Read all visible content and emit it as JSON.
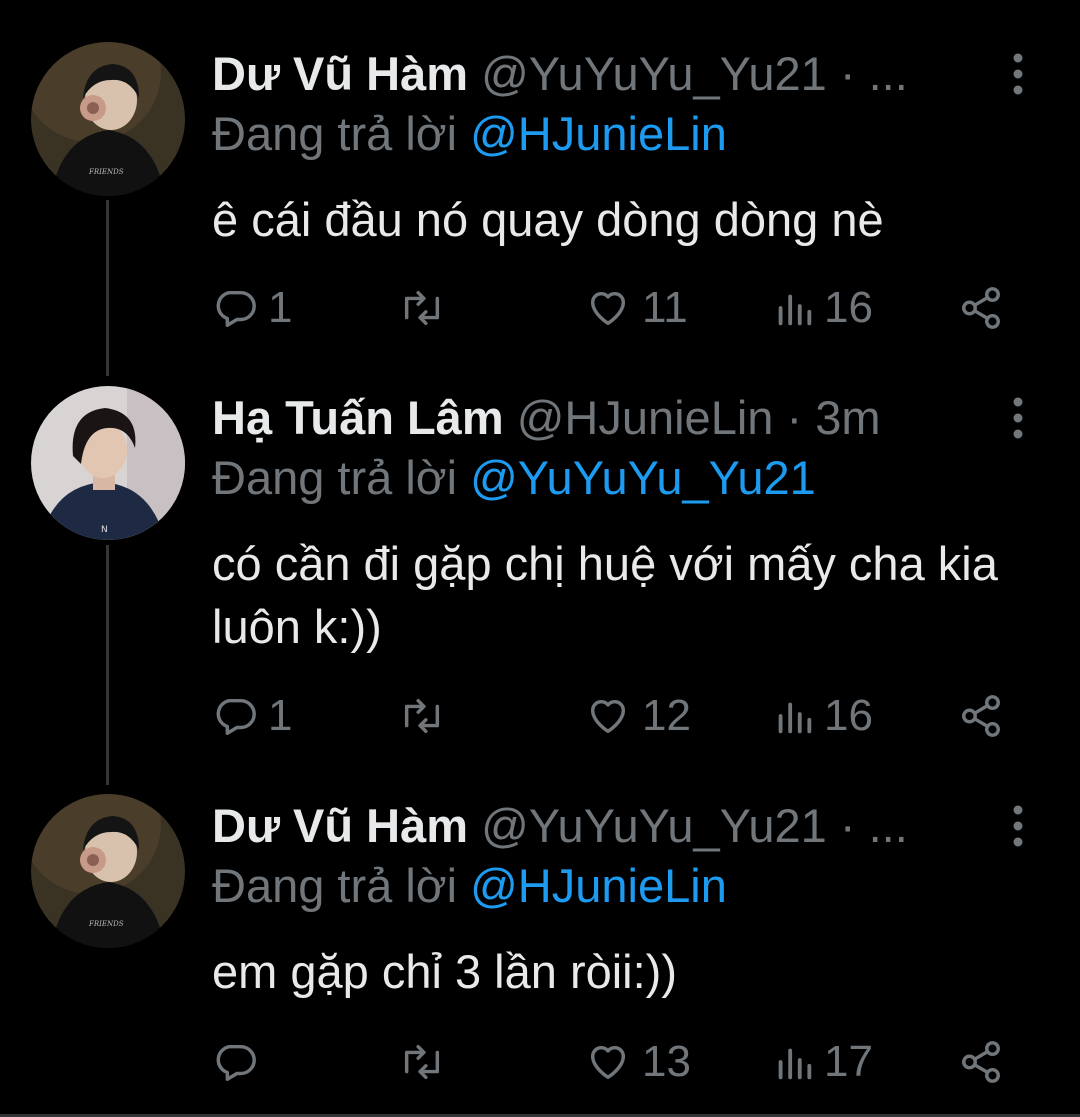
{
  "tweets": [
    {
      "display_name": "Dư Vũ Hàm",
      "handle": "@YuYuYu_Yu21",
      "meta_suffix": " · ...",
      "replying_prefix": "Đang trả lời ",
      "replying_to": "@HJunieLin",
      "text": "ê cái đầu nó quay dòng dòng nè",
      "replies": "1",
      "retweets": "",
      "likes": "11",
      "views": "16"
    },
    {
      "display_name": "Hạ Tuấn Lâm",
      "handle": "@HJunieLin",
      "meta_suffix": " · 3m",
      "replying_prefix": "Đang trả lời ",
      "replying_to": "@YuYuYu_Yu21",
      "text": "có cần đi gặp chị huệ với mấy cha kia luôn k:))",
      "replies": "1",
      "retweets": "",
      "likes": "12",
      "views": "16"
    },
    {
      "display_name": "Dư Vũ Hàm",
      "handle": "@YuYuYu_Yu21",
      "meta_suffix": " · ...",
      "replying_prefix": "Đang trả lời ",
      "replying_to": "@HJunieLin",
      "text": "em gặp chỉ 3 lần ròii:))",
      "replies": "",
      "retweets": "",
      "likes": "13",
      "views": "17"
    }
  ],
  "colors": {
    "background": "#000000",
    "text": "#e7e9ea",
    "muted": "#71767b",
    "link": "#1d9bf0"
  },
  "icons": [
    "reply-icon",
    "retweet-icon",
    "like-icon",
    "views-icon",
    "share-icon",
    "more-icon"
  ]
}
